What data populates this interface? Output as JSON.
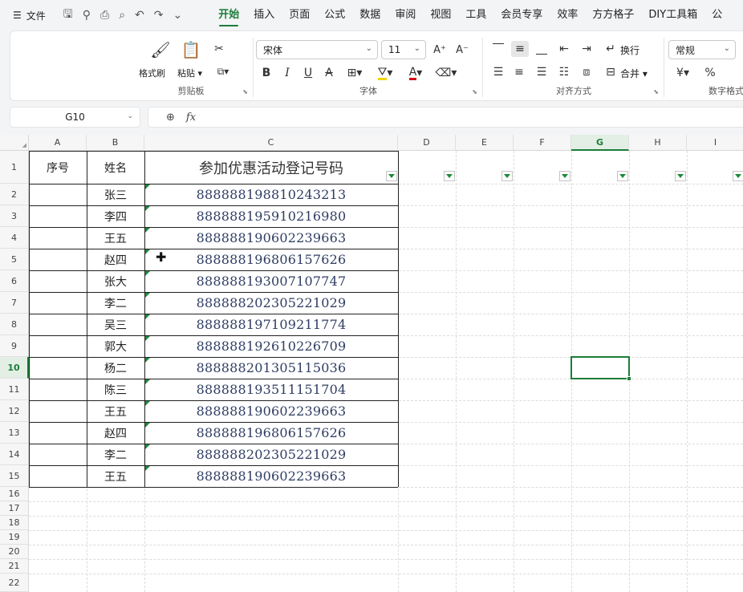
{
  "menubar": {
    "file_label": "文件",
    "tabs": [
      {
        "label": "开始",
        "active": true
      },
      {
        "label": "插入"
      },
      {
        "label": "页面"
      },
      {
        "label": "公式"
      },
      {
        "label": "数据"
      },
      {
        "label": "审阅"
      },
      {
        "label": "视图"
      },
      {
        "label": "工具"
      },
      {
        "label": "会员专享"
      },
      {
        "label": "效率"
      },
      {
        "label": "方方格子"
      },
      {
        "label": "DIY工具箱"
      },
      {
        "label": "公"
      }
    ]
  },
  "ribbon": {
    "clipboard": {
      "format_painter": "格式刷",
      "paste": "粘贴",
      "group_label": "剪贴板"
    },
    "font": {
      "font_name": "宋体",
      "font_size": "11",
      "group_label": "字体",
      "fill_color": "#f2d600",
      "font_color": "#d40000"
    },
    "alignment": {
      "wrap": "换行",
      "merge": "合并",
      "group_label": "对齐方式"
    },
    "number": {
      "format": "常规",
      "group_label": "数字格式"
    }
  },
  "formula_bar": {
    "name_box": "G10",
    "fx": "fx",
    "content": ""
  },
  "sheet": {
    "columns": [
      "A",
      "B",
      "C",
      "D",
      "E",
      "F",
      "G",
      "H",
      "I"
    ],
    "active_column": "G",
    "rows": [
      "1",
      "2",
      "3",
      "4",
      "5",
      "6",
      "7",
      "8",
      "9",
      "10",
      "11",
      "12",
      "13",
      "14",
      "15",
      "16",
      "17",
      "18",
      "19",
      "20",
      "21",
      "22"
    ],
    "active_row": "10",
    "headers": {
      "a": "序号",
      "b": "姓名",
      "c": "参加优惠活动登记号码"
    },
    "records": [
      {
        "name": "张三",
        "number": "888888198810243213"
      },
      {
        "name": "李四",
        "number": "888888195910216980"
      },
      {
        "name": "王五",
        "number": "888888190602239663"
      },
      {
        "name": "赵四",
        "number": "888888196806157626"
      },
      {
        "name": "张大",
        "number": "888888193007107747"
      },
      {
        "name": "李二",
        "number": "888888202305221029"
      },
      {
        "name": "吴三",
        "number": "888888197109211774"
      },
      {
        "name": "郭大",
        "number": "888888192610226709"
      },
      {
        "name": "杨二",
        "number": "888888201305115036"
      },
      {
        "name": "陈三",
        "number": "888888193511151704"
      },
      {
        "name": "王五",
        "number": "888888190602239663"
      },
      {
        "name": "赵四",
        "number": "888888196806157626"
      },
      {
        "name": "李二",
        "number": "888888202305221029"
      },
      {
        "name": "王五",
        "number": "888888190602239663"
      }
    ],
    "accent": "#1c7d3a"
  }
}
